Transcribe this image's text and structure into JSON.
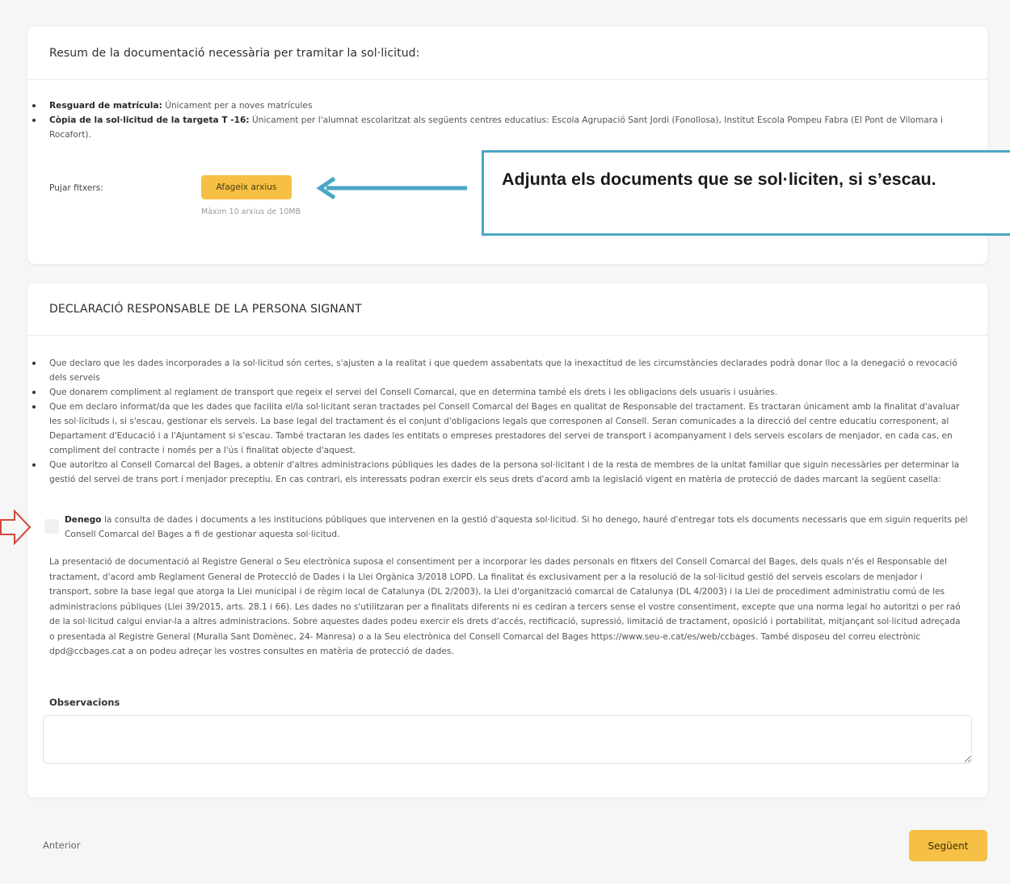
{
  "documents_card": {
    "title": "Resum de la documentació necessària per tramitar la sol·licitud:",
    "items": [
      {
        "label": "Resguard de matrícula:",
        "text": " Únicament per a noves matrícules"
      },
      {
        "label": "Còpia de la sol·licitud de la targeta T -16:",
        "text": " Únicament per l'alumnat escolaritzat als següents centres educatius: Escola Agrupació Sant Jordi (Fonollosa), Institut Escola Pompeu Fabra (El Pont de Vilomara i Rocafort)."
      }
    ],
    "upload_label": "Pujar fitxers:",
    "upload_button": "Afageix arxius",
    "upload_hint": "Màxim 10 arxius de 10MB"
  },
  "callout": {
    "text": "Adjunta els documents que se sol·liciten, si s’escau.",
    "border_color": "#4ba6c3"
  },
  "declaration_card": {
    "title": "DECLARACIÓ RESPONSABLE DE LA PERSONA SIGNANT",
    "items": [
      "Que declaro que les dades incorporades a la sol·licitud són certes, s'ajusten a la realitat i que quedem assabentats que la inexactitud de les circumstàncies declarades podrà donar lloc a la denegació o revocació dels serveis",
      "Que donarem compliment al reglament de transport que regeix el servei del Consell Comarcal, que en determina també els drets i les obligacions dels usuaris i usuàries.",
      "Que em declaro informat/da que les dades que facilita el/la sol·licitant seran tractades pel Consell Comarcal del Bages en qualitat de Responsable del tractament. Es tractaran únicament amb la finalitat d'avaluar les sol·licituds i, si s'escau, gestionar els serveis. La base legal del tractament és el conjunt d'obligacions legals que corresponen al Consell. Seran comunicades a la direcció del centre educatiu corresponent, al Departament d'Educació i a l'Ajuntament si s'escau. També tractaran les dades les entitats o empreses prestadores del servei de transport i acompanyament i dels serveis escolars de menjador, en cada cas, en compliment del contracte i només per a l'ús i finalitat objecte d'aquest.",
      "Que autoritzo al Consell Comarcal del Bages, a obtenir d'altres administracions públiques les dades de la persona sol·licitant i de la resta de membres de la unitat familiar que siguin necessàries per determinar la gestió del servei de trans port i menjador preceptiu. En cas contrari, els interessats podran exercir els seus drets d'acord amb la legislació vigent en matèria de protecció de dades marcant la següent casella:"
    ],
    "checkbox_bold": "Denego",
    "checkbox_text": " la consulta de dades i documents a les institucions públiques que intervenen en la gestió d'aquesta sol·licitud. Si ho denego, hauré d'entregar tots els documents necessaris que em siguin requerits pel Consell Comarcal del Bages a fi de gestionar aquesta sol·licitud.",
    "legal_text": "La presentació de documentació al Registre General o Seu electrònica suposa el consentiment per a incorporar les dades personals en fitxers del Consell Comarcal del Bages, dels quals n'és el Responsable del tractament, d'acord amb Reglament General de Protecció de Dades i la Llei Orgànica 3/2018 LOPD. La finalitat és exclusivament per a la resolució de la sol·licitud gestió del serveis escolars de menjador i transport, sobre la base legal que atorga la Llei municipal i de règim local de Catalunya (DL 2/2003), la Llei d'organització comarcal de Catalunya (DL 4/2003) i la Llei de procediment administratiu comú de les administracions públiques (Llei 39/2015, arts. 28.1 i 66). Les dades no s'utilitzaran per a finalitats diferents ni es cediran a tercers sense el vostre consentiment, excepte que una norma legal ho autoritzi o per raó de la sol·licitud calgui enviar-la a altres administracions. Sobre aquestes dades podeu exercir els drets d'accés, rectificació, supressió, limitació de tractament, oposició i portabilitat, mitjançant sol·licitud adreçada o presentada al Registre General (Muralla Sant Domènec, 24- Manresa) o a la Seu electrònica del Consell Comarcal del Bages https://www.seu-e.cat/es/web/ccbages. També disposeu del correu electrònic dpd@ccbages.cat a on podeu adreçar les vostres consultes en matèria de protecció de dades.",
    "observations_label": "Observacions",
    "observations_value": ""
  },
  "footer": {
    "prev_label": "Anterior",
    "next_label": "Següent"
  },
  "colors": {
    "accent_button": "#f5c043",
    "callout_arrow": "#4ba6c3",
    "hollow_arrow": "#d04a3a"
  }
}
